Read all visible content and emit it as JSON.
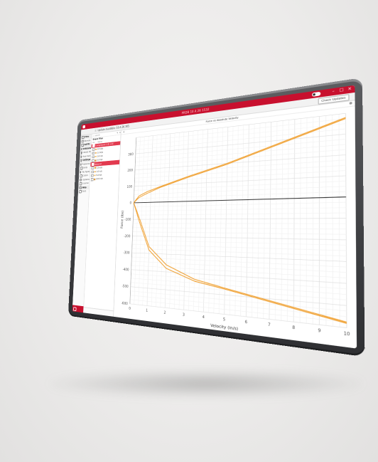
{
  "window": {
    "title": "PRDB 10.4.26 1532",
    "check_updates_label": "Check Updates",
    "update_banner": "Update available: 10.4.26.305"
  },
  "nav": {
    "items": [
      {
        "label": "Files",
        "section": true,
        "icon": "folder-icon"
      },
      {
        "label": "Browse",
        "icon": "browse-icon"
      },
      {
        "label": "SAPPL",
        "section": true,
        "icon": "sappl-icon"
      },
      {
        "label": "Validation",
        "section": true,
        "icon": "check-icon"
      },
      {
        "label": "Create Validation",
        "icon": "plus-icon"
      },
      {
        "label": "View Validation",
        "icon": "eye-icon"
      },
      {
        "label": "Settings",
        "section": true,
        "icon": "gear-icon"
      },
      {
        "label": "Preferences",
        "icon": "sliders-icon"
      },
      {
        "label": "Units",
        "icon": "ruler-icon"
      },
      {
        "label": "File Types",
        "icon": "file-icon"
      },
      {
        "label": "Colors",
        "icon": "palette-icon"
      },
      {
        "label": "Updates",
        "icon": "refresh-icon"
      },
      {
        "label": "License",
        "icon": "key-icon"
      },
      {
        "label": "Help",
        "section": true,
        "icon": "help-icon"
      },
      {
        "label": "Docs",
        "icon": "book-icon"
      }
    ]
  },
  "files": {
    "search_placeholder": "search",
    "title": "Shock Files",
    "col_on": "On",
    "col_name": "Name",
    "rows": [
      {
        "label": "Compression 1 @ 1.00",
        "group": true
      },
      {
        "label": "0.5 in/s",
        "color": "#f0a030"
      },
      {
        "label": "1.0 in/s",
        "color": "#e8a23a"
      },
      {
        "label": "2.0 in/s",
        "color": "#f3b84f"
      },
      {
        "label": "5.0 in/s",
        "color": "#d89030"
      },
      {
        "label": "Rebound",
        "group": true
      },
      {
        "label": "0.5 in/s",
        "color": "#f0a030"
      },
      {
        "label": "1.0 in/s",
        "color": "#e8a23a"
      },
      {
        "label": "5.0 in/s",
        "color": "#f3b84f"
      },
      {
        "label": "10.0 in/s",
        "color": "#d89030"
      }
    ]
  },
  "chart_data": {
    "type": "line",
    "title": "Force vs Absolute Velocity",
    "xlabel": "Velocity (in/s)",
    "ylabel": "Force (lbs)",
    "xlim": [
      0,
      10
    ],
    "ylim": [
      -600,
      400
    ],
    "x_ticks": [
      "0",
      "1",
      "2",
      "3",
      "4",
      "5",
      "6",
      "7",
      "8",
      "9",
      "10"
    ],
    "y_ticks": [
      "300",
      "200",
      "100",
      "0",
      "-100",
      "-200",
      "-300",
      "-400",
      "-500",
      "-600"
    ],
    "grid": true,
    "series_color": "#f0a030",
    "series": [
      {
        "x": [
          0,
          0.3,
          0.8,
          1.5,
          3,
          5,
          10
        ],
        "y": [
          0,
          40,
          65,
          90,
          140,
          200,
          380
        ]
      },
      {
        "x": [
          0,
          0.3,
          0.8,
          1.5,
          3,
          5,
          10
        ],
        "y": [
          0,
          30,
          55,
          85,
          135,
          195,
          375
        ]
      },
      {
        "x": [
          0,
          0.4,
          1.0,
          2.0,
          3.5,
          5,
          10
        ],
        "y": [
          0,
          -120,
          -280,
          -380,
          -440,
          -470,
          -580
        ]
      },
      {
        "x": [
          0,
          0.4,
          1.0,
          2.0,
          3.5,
          5,
          10
        ],
        "y": [
          0,
          -100,
          -260,
          -360,
          -430,
          -465,
          -575
        ]
      }
    ]
  }
}
